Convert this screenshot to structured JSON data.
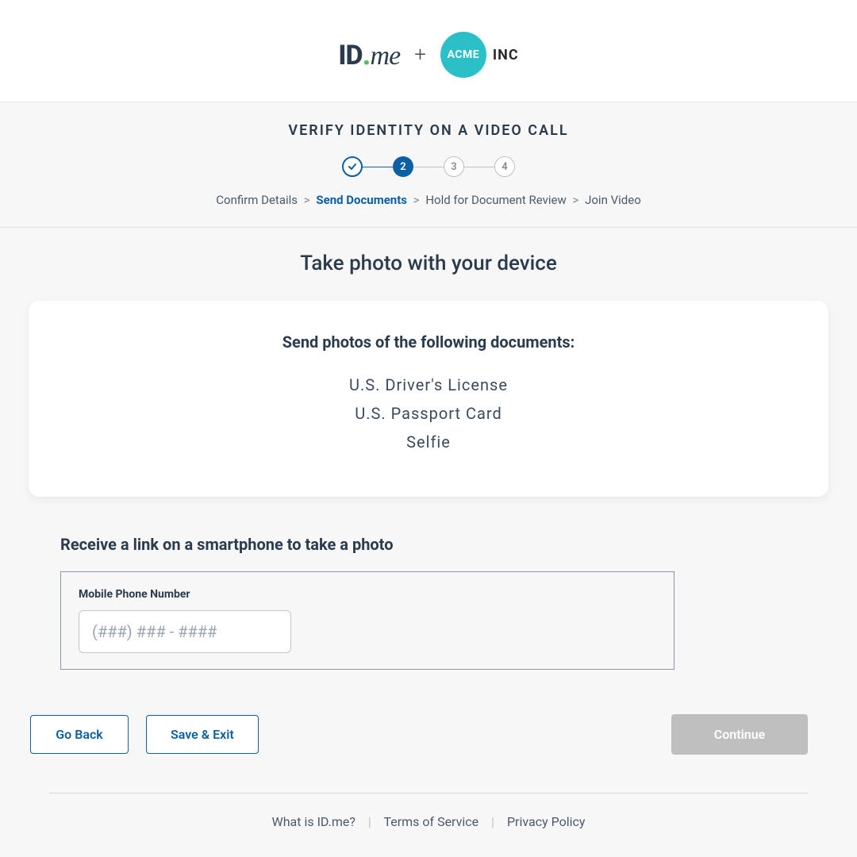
{
  "header": {
    "idme_id": "ID",
    "idme_dot": ".",
    "idme_me": "me",
    "plus": "+",
    "acme_circle": "ACME",
    "acme_inc": "INC"
  },
  "progress": {
    "title": "VERIFY IDENTITY ON A VIDEO CALL",
    "step2": "2",
    "step3": "3",
    "step4": "4"
  },
  "breadcrumb": {
    "s1": "Confirm Details",
    "s2": "Send Documents",
    "s3": "Hold for Document Review",
    "s4": "Join Video",
    "sep": ">"
  },
  "main": {
    "title": "Take photo with your device",
    "card_heading": "Send photos of the following documents:",
    "documents": [
      "U.S. Driver's License",
      "U.S. Passport Card",
      "Selfie"
    ],
    "link_heading": "Receive a link on a smartphone to take a photo",
    "phone_label": "Mobile Phone Number",
    "phone_placeholder": "(###) ### - ####",
    "phone_value": ""
  },
  "buttons": {
    "go_back": "Go Back",
    "save_exit": "Save & Exit",
    "continue": "Continue"
  },
  "footer": {
    "what": "What is ID.me?",
    "tos": "Terms of Service",
    "privacy": "Privacy Policy",
    "sep": "|"
  }
}
